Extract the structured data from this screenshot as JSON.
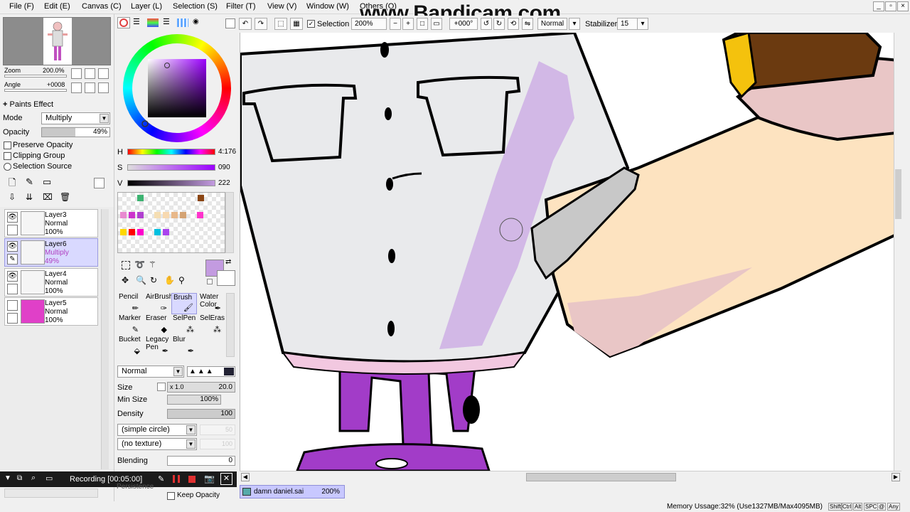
{
  "menu": [
    "File (F)",
    "Edit (E)",
    "Canvas (C)",
    "Layer (L)",
    "Selection (S)",
    "Filter (T)",
    "View (V)",
    "Window (W)",
    "Others (O)"
  ],
  "watermark": "www.Bandicam.com",
  "toolbar": {
    "selection_label": "Selection",
    "zoom_value": "200%",
    "angle_value": "+000°",
    "mode_value": "Normal",
    "stabilizer_label": "Stabilizer",
    "stabilizer_value": "15"
  },
  "navigator": {
    "zoom_label": "Zoom",
    "zoom_value": "200.0%",
    "angle_label": "Angle",
    "angle_value": "+0008"
  },
  "layer_props": {
    "paints_effect": "Paints Effect",
    "mode_label": "Mode",
    "mode_value": "Multiply",
    "opacity_label": "Opacity",
    "opacity_value": "49%",
    "opacity_fraction": 0.49,
    "preserve_opacity": "Preserve Opacity",
    "clipping_group": "Clipping Group",
    "selection_source": "Selection Source"
  },
  "layers": [
    {
      "name": "Layer3",
      "mode": "Normal",
      "opacity": "100%"
    },
    {
      "name": "Layer6",
      "mode": "Multiply",
      "opacity": "49%"
    },
    {
      "name": "Layer4",
      "mode": "Normal",
      "opacity": "100%"
    },
    {
      "name": "Layer5",
      "mode": "Normal",
      "opacity": "100%"
    }
  ],
  "color": {
    "h_label": "H",
    "h_value": "4:176",
    "s_label": "S",
    "s_value": "090",
    "v_label": "V",
    "v_value": "222",
    "current": "#c39be0"
  },
  "tools": [
    {
      "label": "Pencil",
      "icon": "pencil-icon"
    },
    {
      "label": "AirBrush",
      "icon": "airbrush-icon"
    },
    {
      "label": "Brush",
      "icon": "brush-icon"
    },
    {
      "label": "Water Color",
      "icon": "watercolor-icon"
    },
    {
      "label": "Marker",
      "icon": "marker-icon"
    },
    {
      "label": "Eraser",
      "icon": "eraser-icon"
    },
    {
      "label": "SelPen",
      "icon": "selpen-icon"
    },
    {
      "label": "SelEras",
      "icon": "seleraser-icon"
    },
    {
      "label": "Bucket",
      "icon": "bucket-icon"
    },
    {
      "label": "Legacy Pen",
      "icon": "legacy-pen-icon"
    },
    {
      "label": "Blur",
      "icon": "blur-icon"
    }
  ],
  "brush": {
    "blend_mode": "Normal",
    "size_label": "Size",
    "size_mult": "x 1.0",
    "size_value": "20.0",
    "min_size_label": "Min Size",
    "min_size_value": "100%",
    "density_label": "Density",
    "density_value": "100",
    "shape": "(simple circle)",
    "shape_value": "50",
    "texture": "(no texture)",
    "texture_value": "100",
    "blending_label": "Blending",
    "blending_value": "0",
    "persistence_label": "Persistence",
    "keep_opacity": "Keep Opacity"
  },
  "recording": {
    "text": "Recording [00:05:00]"
  },
  "document": {
    "name": "damn daniel.sai",
    "zoom": "200%"
  },
  "status": {
    "memory": "Memory Ussage:32% (Use1327MB/Max4095MB)",
    "keys": [
      "Shift",
      "Ctrl",
      "Alt",
      "SPC",
      "@",
      "Any"
    ]
  },
  "colors": {
    "selection_highlight": "#d9d9ff",
    "canvas_purple": "#a23cc8",
    "canvas_lavender": "#c9a7e4",
    "skin": "#fde3c0"
  },
  "swatches": [
    "#3cb371",
    "#8b4513",
    "#e88ad0",
    "#cc33cc",
    "#b040d0",
    "#f5deb3",
    "#f7d9b0",
    "#e8b88a",
    "#d4a373",
    "#ff33cc",
    "#ffd700",
    "#ff0000",
    "#ff00cc",
    "#00c0e0",
    "#aa44ee"
  ]
}
